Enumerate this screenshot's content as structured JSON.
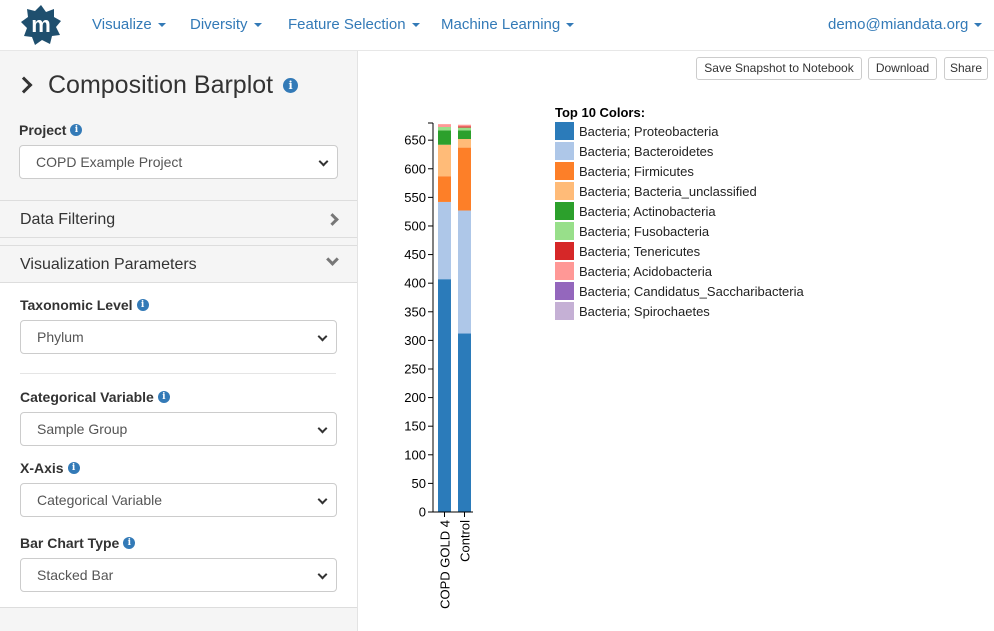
{
  "nav": {
    "logo_letter": "m",
    "menu": [
      "Visualize",
      "Diversity",
      "Feature Selection",
      "Machine Learning"
    ],
    "user": "demo@miandata.org"
  },
  "sidebar": {
    "title": "Composition Barplot",
    "project_label": "Project",
    "project_value": "COPD Example Project",
    "data_filtering": "Data Filtering",
    "viz_params": "Visualization Parameters",
    "taxonomic_label": "Taxonomic Level",
    "taxonomic_value": "Phylum",
    "categorical_label": "Categorical Variable",
    "categorical_value": "Sample Group",
    "xaxis_label": "X-Axis",
    "xaxis_value": "Categorical Variable",
    "chart_type_label": "Bar Chart Type",
    "chart_type_value": "Stacked Bar"
  },
  "toolbar": {
    "snapshot": "Save Snapshot to Notebook",
    "download": "Download",
    "share": "Share"
  },
  "legend_title": "Top 10 Colors:",
  "colors": [
    "#2b7bba",
    "#aec7e8",
    "#fd7f28",
    "#ffbb78",
    "#2ca02c",
    "#98df8a",
    "#d62728",
    "#ff9896",
    "#9467bd",
    "#c5b0d5"
  ],
  "chart_data": {
    "type": "bar",
    "stacked": true,
    "categories": [
      "COPD GOLD 4",
      "Control"
    ],
    "ylim": [
      0,
      680
    ],
    "yticks": [
      0,
      50,
      100,
      150,
      200,
      250,
      300,
      350,
      400,
      450,
      500,
      550,
      600,
      650
    ],
    "series": [
      {
        "name": "Bacteria; Proteobacteria",
        "values": [
          407,
          312
        ]
      },
      {
        "name": "Bacteria; Bacteroidetes",
        "values": [
          135,
          215
        ]
      },
      {
        "name": "Bacteria; Firmicutes",
        "values": [
          45,
          110
        ]
      },
      {
        "name": "Bacteria; Bacteria_unclassified",
        "values": [
          55,
          15
        ]
      },
      {
        "name": "Bacteria; Actinobacteria",
        "values": [
          25,
          15
        ]
      },
      {
        "name": "Bacteria; Fusobacteria",
        "values": [
          6,
          5
        ]
      },
      {
        "name": "Bacteria; Tenericutes",
        "values": [
          0,
          2
        ]
      },
      {
        "name": "Bacteria; Acidobacteria",
        "values": [
          5,
          3
        ]
      },
      {
        "name": "Bacteria; Candidatus_Saccharibacteria",
        "values": [
          0,
          0
        ]
      },
      {
        "name": "Bacteria; Spirochaetes",
        "values": [
          0,
          0
        ]
      }
    ]
  }
}
